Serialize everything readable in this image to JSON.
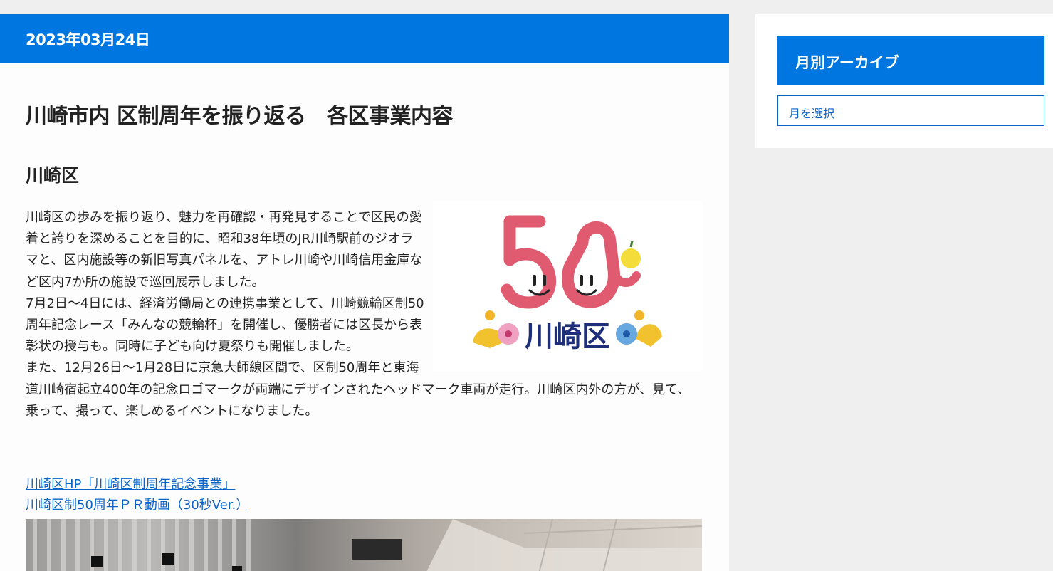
{
  "article": {
    "date": "2023年03月24日",
    "title": "川崎市内 区制周年を振り返る　各区事業内容",
    "section_title": "川崎区",
    "paragraphs": [
      "川崎区の歩みを振り返り、魅力を再確認・再発見することで区民の愛着と誇りを深めることを目的に、昭和38年頃のJR川崎駅前のジオラマと、区内施設等の新旧写真パネルを、アトレ川崎や川崎信用金庫など区内7か所の施設で巡回展示しました。",
      "7月2日〜4日には、経済労働局との連携事業として、川崎競輪区制50周年記念レース「みんなの競輪杯」を開催し、優勝者には区長から表彰状の授与も。同時に子ども向け夏祭りも開催しました。",
      "また、12月26日〜1月28日に京急大師線区間で、区制50周年と東海道川崎宿起立400年の記念ロゴマークが両端にデザインされたヘッドマーク車両が走行。川崎区内外の方が、見て、乗って、撮って、楽しめるイベントになりました。"
    ],
    "logo": {
      "number": "50",
      "name": "川崎区"
    },
    "links": [
      "川崎区HP「川崎区制周年記念事業」",
      "川崎区制50周年ＰＲ動画（30秒Ver.）"
    ]
  },
  "sidebar": {
    "archive_title": "月別アーカイブ",
    "month_select_value": "月を選択"
  },
  "colors": {
    "accent": "#0076e0",
    "link": "#0a64c8",
    "logo_pink": "#e05a70",
    "logo_navy": "#1e2f7a"
  }
}
